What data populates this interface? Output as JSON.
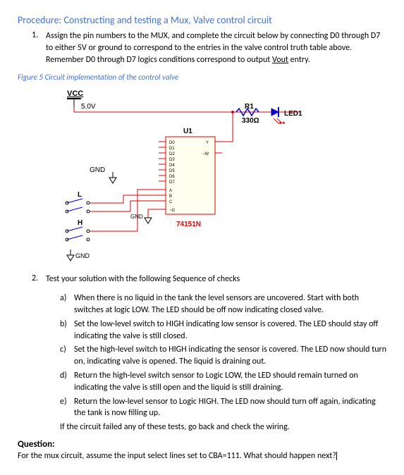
{
  "title": "Procedure: Constructing and testing a Mux, Valve control circuit",
  "proc1_num": "1.",
  "proc1_text_a": "Assign the pin numbers to the MUX, and complete the circuit below by connecting D0 through D7 to either 5V or ground to correspond to the entries in the valve control truth table above. Remember D0 through D7 logics conditions correspond to output ",
  "proc1_vout": "Vout",
  "proc1_text_b": " entry.",
  "fig_caption": "Figure 5 Circuit implementation of the control valve",
  "diagram": {
    "vcc": "VCC",
    "volt": "5.0V",
    "gnd1": "GND",
    "gnd2": "GND",
    "gnd3": "GND",
    "L": "L",
    "H": "H",
    "U1": "U1",
    "part": "74151N",
    "R1": "R1",
    "Rval": "330Ω",
    "LED1": "LED1",
    "D0": "D0",
    "D1": "D1",
    "D2": "D2",
    "D3": "D3",
    "D4": "D4",
    "D5": "D5",
    "D6": "D6",
    "D7": "D7",
    "A": "A",
    "B": "B",
    "C": "C",
    "G": "~G",
    "Y": "Y",
    "W": "~W"
  },
  "proc2_num": "2.",
  "proc2_text": "Test your solution with the following Sequence of checks",
  "checks": {
    "a_l": "a)",
    "a": "When there is no liquid in the tank the level sensors are uncovered. Start with both switches at logic LOW. The LED should be off now indicating closed valve.",
    "b_l": "b)",
    "b": "Set the low-level switch to HIGH indicating low sensor is covered. The LED should stay off indicating the valve is still closed.",
    "c_l": "c)",
    "c": "Set the high-level switch to HIGH indicating the sensor is covered. The LED now should turn on, indicating valve is opened. The liquid is draining out.",
    "d_l": "d)",
    "d": "Return the high-level switch sensor to Logic LOW, the LED should remain turned on indicating the valve is still open and the liquid is still draining.",
    "e_l": "e)",
    "e": "Return the low-level sensor to Logic HIGH. The LED now should turn off again, indicating the tank is now filling up."
  },
  "closing": "If the circuit failed any of these tests, go back and check the wiring.",
  "question_head": "Question:",
  "question_text": "For the mux circuit, assume the input select lines set to CBA=111. What should happen next?"
}
